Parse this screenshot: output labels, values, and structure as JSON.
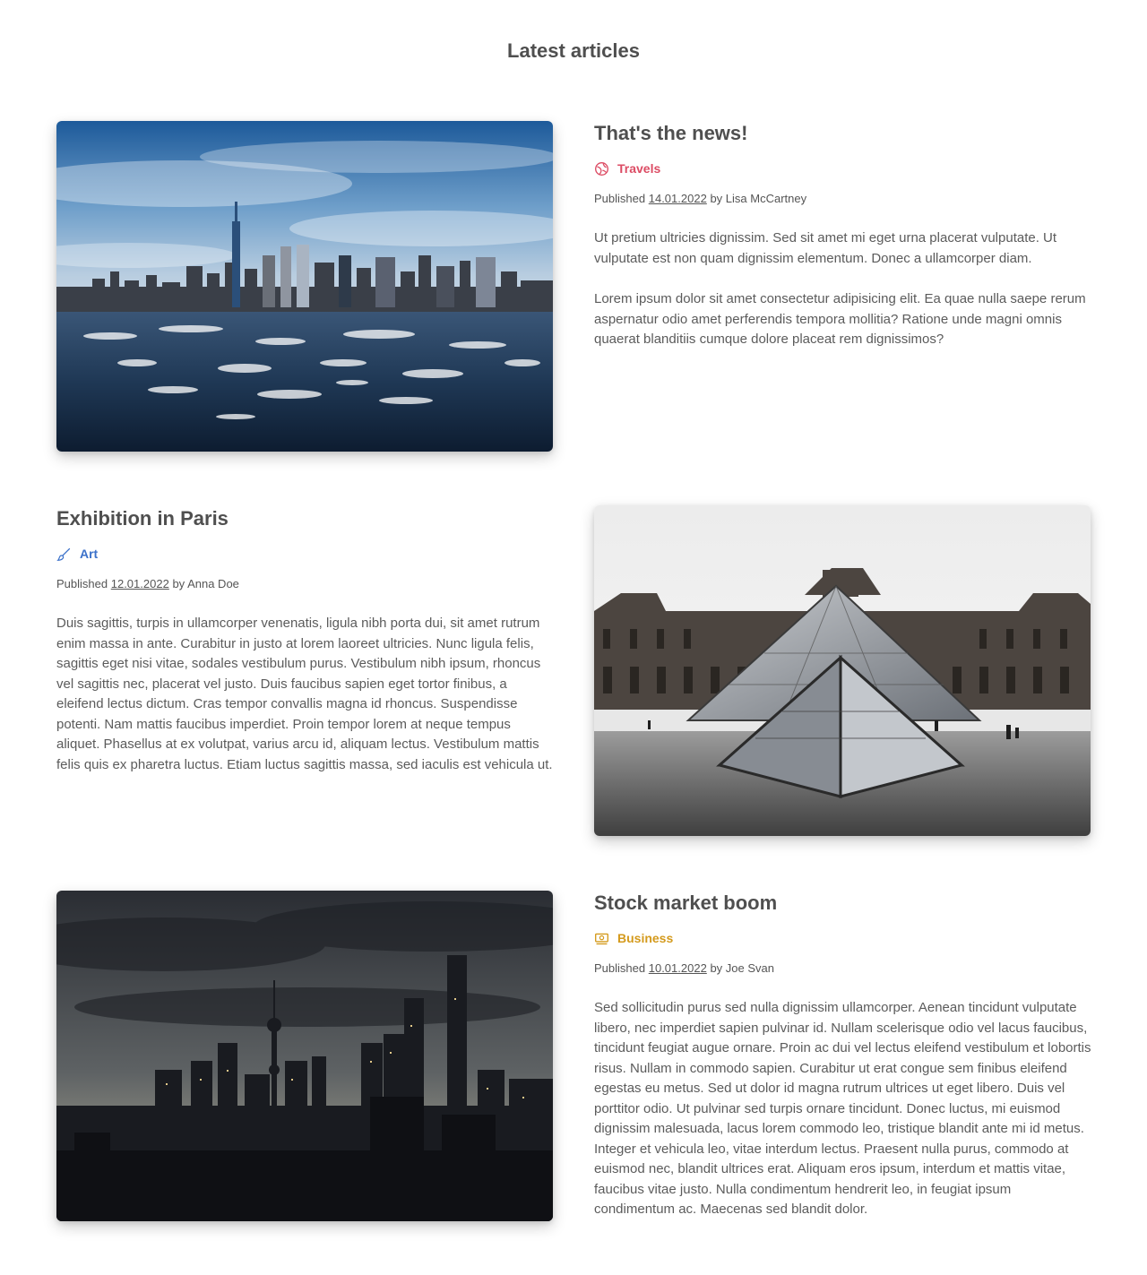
{
  "section": {
    "title": "Latest articles"
  },
  "articles": [
    {
      "title": "That's the news!",
      "category": "Travels",
      "category_color": "#dc4c64",
      "category_icon": "globe-icon",
      "published_prefix": "Published",
      "date": "14.01.2022",
      "by_prefix": "by",
      "author": "Lisa McCartney",
      "paragraphs": [
        "Ut pretium ultricies dignissim. Sed sit amet mi eget urna placerat vulputate. Ut vulputate est non quam dignissim elementum. Donec a ullamcorper diam.",
        "Lorem ipsum dolor sit amet consectetur adipisicing elit. Ea quae nulla saepe rerum aspernatur odio amet perferendis tempora mollitia? Ratione unde magni omnis quaerat blanditiis cumque dolore placeat rem dignissimos?"
      ]
    },
    {
      "title": "Exhibition in Paris",
      "category": "Art",
      "category_color": "#3b71ca",
      "category_icon": "paint-brush-icon",
      "published_prefix": "Published",
      "date": "12.01.2022",
      "by_prefix": "by",
      "author": "Anna Doe",
      "paragraphs": [
        "Duis sagittis, turpis in ullamcorper venenatis, ligula nibh porta dui, sit amet rutrum enim massa in ante. Curabitur in justo at lorem laoreet ultricies. Nunc ligula felis, sagittis eget nisi vitae, sodales vestibulum purus. Vestibulum nibh ipsum, rhoncus vel sagittis nec, placerat vel justo. Duis faucibus sapien eget tortor finibus, a eleifend lectus dictum. Cras tempor convallis magna id rhoncus. Suspendisse potenti. Nam mattis faucibus imperdiet. Proin tempor lorem at neque tempus aliquet. Phasellus at ex volutpat, varius arcu id, aliquam lectus. Vestibulum mattis felis quis ex pharetra luctus. Etiam luctus sagittis massa, sed iaculis est vehicula ut."
      ]
    },
    {
      "title": "Stock market boom",
      "category": "Business",
      "category_color": "#d49a1c",
      "category_icon": "money-bill-icon",
      "published_prefix": "Published",
      "date": "10.01.2022",
      "by_prefix": "by",
      "author": "Joe Svan",
      "paragraphs": [
        "Sed sollicitudin purus sed nulla dignissim ullamcorper. Aenean tincidunt vulputate libero, nec imperdiet sapien pulvinar id. Nullam scelerisque odio vel lacus faucibus, tincidunt feugiat augue ornare. Proin ac dui vel lectus eleifend vestibulum et lobortis risus. Nullam in commodo sapien. Curabitur ut erat congue sem finibus eleifend egestas eu metus. Sed ut dolor id magna rutrum ultrices ut eget libero. Duis vel porttitor odio. Ut pulvinar sed turpis ornare tincidunt. Donec luctus, mi euismod dignissim malesuada, lacus lorem commodo leo, tristique blandit ante mi id metus. Integer et vehicula leo, vitae interdum lectus. Praesent nulla purus, commodo at euismod nec, blandit ultrices erat. Aliquam eros ipsum, interdum et mattis vitae, faucibus vitae justo. Nulla condimentum hendrerit leo, in feugiat ipsum condimentum ac. Maecenas sed blandit dolor."
      ]
    }
  ]
}
